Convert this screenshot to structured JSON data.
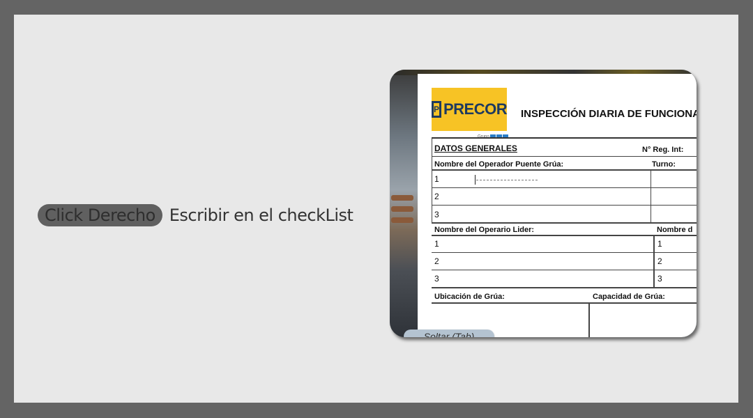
{
  "hint": {
    "action": "Click Derecho",
    "description": "Escribir en el checkList"
  },
  "checklist": {
    "logo": {
      "name": "PRECOR",
      "mark": "P",
      "sub": "Grupo"
    },
    "title": "INSPECCIÓN DIARIA DE  FUNCIONA",
    "section_general": "DATOS GENERALES",
    "reg_label": "N° Reg. Int:",
    "operator_label": "Nombre del Operador Puente Grúa:",
    "shift_label": "Turno:",
    "operator_rows": [
      "1",
      "2",
      "3"
    ],
    "leader_label": "Nombre del Operario Lider:",
    "second_label": "Nombre d",
    "leader_rows": [
      "1",
      "2",
      "3"
    ],
    "second_rows": [
      "1",
      "2",
      "3"
    ],
    "location_label": "Ubicación de Grúa:",
    "capacity_label": "Capacidad de Grúa:"
  },
  "release_button": "Soltar (Tab)",
  "colors": {
    "frame": "#646464",
    "panel": "#e8e8e8",
    "logo_bg": "#f7c325",
    "logo_text": "#1e3a5f",
    "release_bg": "#b4c3d1"
  }
}
